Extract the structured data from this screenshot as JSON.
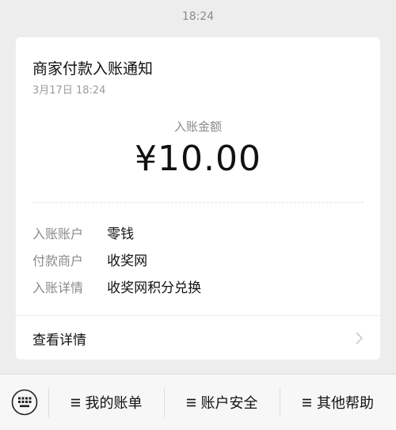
{
  "header": {
    "timestamp": "18:24"
  },
  "card": {
    "title": "商家付款入账通知",
    "date": "3月17日  18:24",
    "amount_label": "入账金额",
    "amount": "¥10.00",
    "details": [
      {
        "key": "入账账户",
        "value": "零钱"
      },
      {
        "key": "付款商户",
        "value": "收奖网"
      },
      {
        "key": "入账详情",
        "value": "收奖网积分兑换"
      }
    ],
    "view_details_label": "查看详情"
  },
  "bottom_bar": {
    "menu": [
      {
        "label": "我的账单",
        "icon": "menu-lines-icon"
      },
      {
        "label": "账户安全",
        "icon": "menu-lines-icon"
      },
      {
        "label": "其他帮助",
        "icon": "menu-lines-icon"
      }
    ],
    "keyboard_icon": "keyboard-icon"
  },
  "colors": {
    "background": "#ededed",
    "card": "#ffffff",
    "muted_text": "#8a8a8a",
    "primary_text": "#111111"
  }
}
